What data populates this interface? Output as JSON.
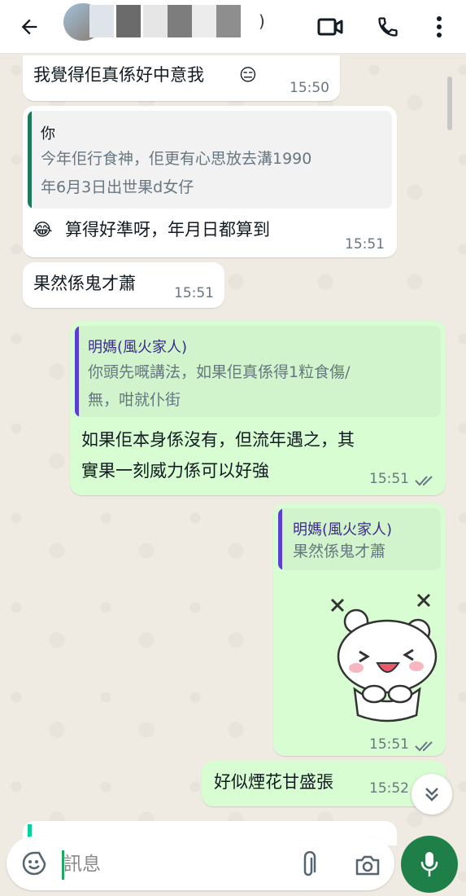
{
  "header": {
    "title_suffix": ")",
    "colors": {
      "bar": "#ffffff",
      "icon": "#111b21"
    },
    "icons": [
      "back-arrow-icon",
      "video-call-icon",
      "phone-icon",
      "more-vertical-icon"
    ]
  },
  "messages": [
    {
      "type": "in",
      "text": "我覺得佢真係好中意我",
      "emoji": "😑",
      "time": "15:50"
    },
    {
      "type": "in",
      "quote": {
        "name": "你",
        "text_line1": "今年佢行食神，佢更有心思放去溝1990",
        "text_line2": "年6月3日出世果d女仔",
        "color": "#1f7a5a"
      },
      "emoji": "😂",
      "text": "算得好準呀，年月日都算到",
      "time": "15:51"
    },
    {
      "type": "in",
      "text": "果然係鬼才蕭",
      "time": "15:51"
    },
    {
      "type": "out",
      "quote": {
        "name": "明媽(風火家人)",
        "text_line1": "你頭先嘅講法，如果佢真係得1粒食傷/",
        "text_line2": "無，咁就仆街",
        "color": "#5c3fd1"
      },
      "text_line1": "如果佢本身係沒有，但流年遇之，其",
      "text_line2": "實果一刻威力係可以好強",
      "time": "15:51"
    },
    {
      "type": "out",
      "quote": {
        "name": "明媽(風火家人)",
        "text_line1": "果然係鬼才蕭",
        "color": "#5c3fd1"
      },
      "sticker": "laughing-bear-sticker",
      "time": "15:51"
    },
    {
      "type": "out",
      "text": "好似煙花甘盛張",
      "time": "15:52"
    }
  ],
  "composer": {
    "placeholder": "訊息",
    "icons": [
      "emoji-icon",
      "attach-icon",
      "camera-icon",
      "mic-icon"
    ],
    "mic_color": "#1f7f49"
  },
  "colors": {
    "incoming": "#ffffff",
    "outgoing": "#d9fdd3",
    "background": "#efeae2",
    "time": "#667781"
  }
}
